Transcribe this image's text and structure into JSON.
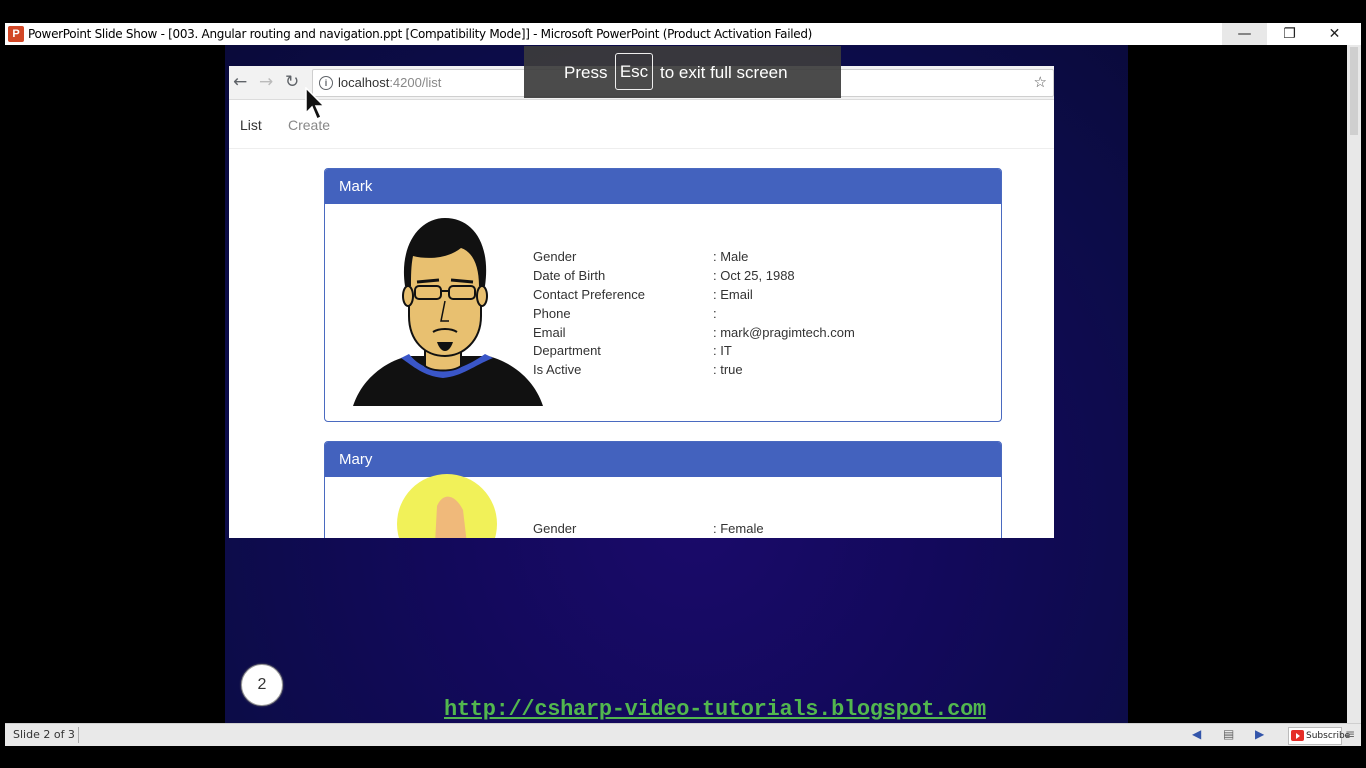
{
  "window": {
    "app_icon": "P",
    "title": "PowerPoint Slide Show - [003. Angular routing and navigation.ppt [Compatibility Mode]] - Microsoft PowerPoint (Product Activation Failed)",
    "minimize_icon": "minimize-icon",
    "restore_icon": "restore-icon",
    "close_icon": "close-icon"
  },
  "fullscreen_notice": {
    "pre": "Press",
    "key": "Esc",
    "post": "to exit full screen"
  },
  "browser": {
    "url_host": "localhost",
    "url_path": ":4200/list"
  },
  "app_nav": {
    "list": "List",
    "create": "Create"
  },
  "employees": [
    {
      "name": "Mark",
      "details": [
        {
          "label": "Gender",
          "value": ": Male"
        },
        {
          "label": "Date of Birth",
          "value": ": Oct 25, 1988"
        },
        {
          "label": "Contact Preference",
          "value": ": Email"
        },
        {
          "label": "Phone",
          "value": ":"
        },
        {
          "label": "Email",
          "value": ": mark@pragimtech.com"
        },
        {
          "label": "Department",
          "value": ": IT"
        },
        {
          "label": "Is Active",
          "value": ": true"
        }
      ]
    },
    {
      "name": "Mary",
      "details": [
        {
          "label": "Gender",
          "value": ": Female"
        }
      ]
    }
  ],
  "slide": {
    "number": "2",
    "link": "http://csharp-video-tutorials.blogspot.com"
  },
  "statusbar": {
    "slide_text": "Slide 2 of 3",
    "subscribe": "Subscribe"
  },
  "colors": {
    "panel_header": "#4362be",
    "link": "#52b74e",
    "slide_bg": "#0c0c48"
  }
}
